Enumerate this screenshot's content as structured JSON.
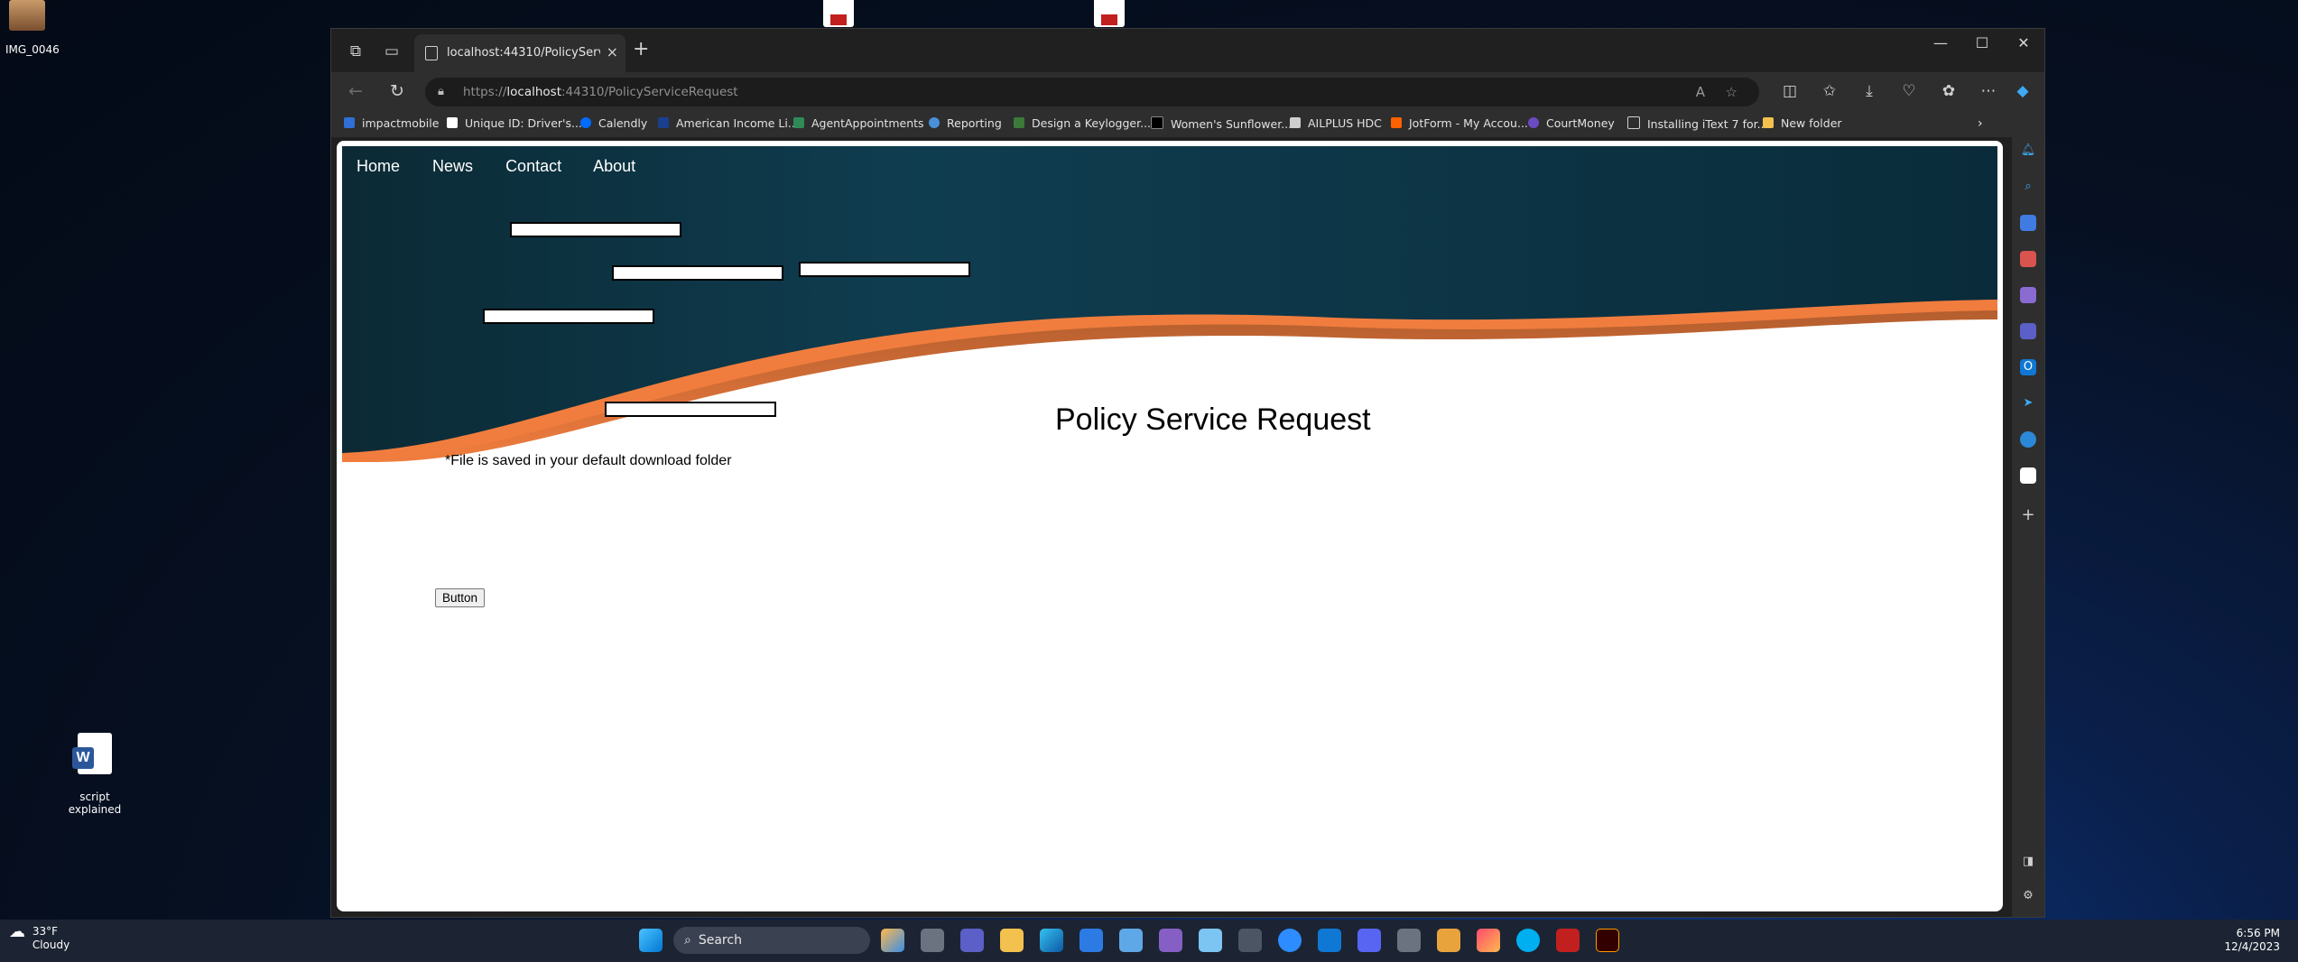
{
  "desktop": {
    "icons": [
      {
        "label": "IMG_0046"
      },
      {
        "label": "script\nexplained"
      }
    ]
  },
  "browser": {
    "tab_title": "localhost:44310/PolicyServiceRe",
    "url_prefix": "https://",
    "url_host": "localhost",
    "url_rest": ":44310/PolicyServiceRequest",
    "bookmarks": [
      {
        "label": "impactmobile",
        "color": "#2f6fd6"
      },
      {
        "label": "Unique ID: Driver's...",
        "color": "#ffffff"
      },
      {
        "label": "Calendly",
        "color": "#006bff"
      },
      {
        "label": "American Income Li...",
        "color": "#1b3f8f"
      },
      {
        "label": "AgentAppointments",
        "color": "#2e8b57"
      },
      {
        "label": "Reporting",
        "color": "#4a90d9"
      },
      {
        "label": "Design a Keylogger...",
        "color": "#3b7a3b"
      },
      {
        "label": "Women's Sunflower...",
        "color": "#000000"
      },
      {
        "label": "AILPLUS HDC",
        "color": "#cfcfcf"
      },
      {
        "label": "JotForm - My Accou...",
        "color": "#ff6100"
      },
      {
        "label": "CourtMoney",
        "color": "#6a4bc4"
      },
      {
        "label": "Installing iText 7 for...",
        "color": "#cfcfcf"
      },
      {
        "label": "New folder",
        "color": "#f2c14e"
      }
    ]
  },
  "site": {
    "menu": [
      "Home",
      "News",
      "Contact",
      "About"
    ],
    "page_title": "Policy Service Request",
    "note": "*File is saved in your default download folder",
    "button_label": "Button",
    "colors": {
      "banner_dark": "#0d3a4f",
      "swoosh": "#f07d3e"
    }
  },
  "taskbar": {
    "search_placeholder": "Search",
    "weather_temp": "33°F",
    "weather_desc": "Cloudy",
    "time": "6:56 PM",
    "date": "12/4/2023"
  }
}
